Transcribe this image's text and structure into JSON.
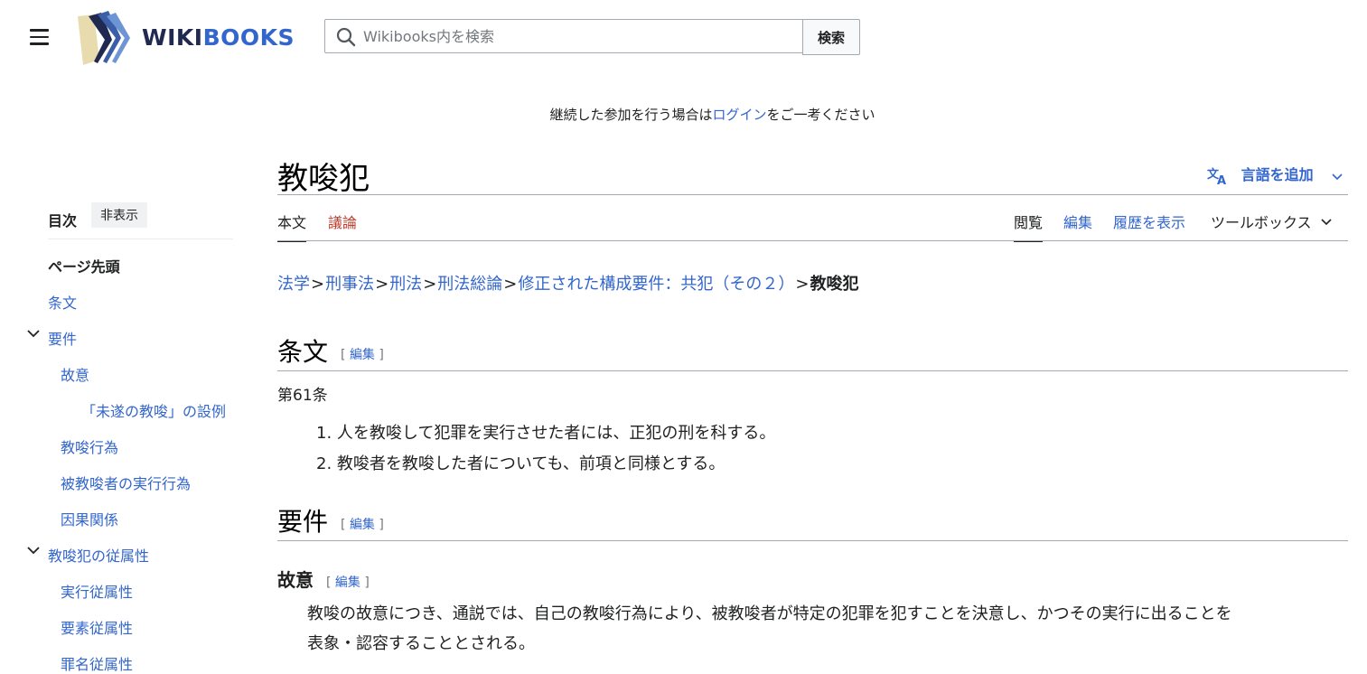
{
  "header": {
    "logo_text_a": "WIKI",
    "logo_text_b": "BOOKS",
    "search_placeholder": "Wikibooks内を検索",
    "search_button": "検索"
  },
  "notice": {
    "before": "継続した参加を行う場合は",
    "link": "ログイン",
    "after": "をご一考ください"
  },
  "toc": {
    "title": "目次",
    "hide": "非表示",
    "items": [
      {
        "label": "ページ先頭",
        "bold": true
      },
      {
        "label": "条文"
      },
      {
        "label": "要件",
        "expandable": true
      },
      {
        "label": "故意"
      },
      {
        "label": "「未遂の教唆」の設例"
      },
      {
        "label": "教唆行為"
      },
      {
        "label": "被教唆者の実行行為"
      },
      {
        "label": "因果関係"
      },
      {
        "label": "教唆犯の従属性",
        "expandable": true
      },
      {
        "label": "実行従属性"
      },
      {
        "label": "要素従属性"
      },
      {
        "label": "罪名従属性"
      }
    ]
  },
  "page": {
    "title": "教唆犯",
    "language_button": "言語を追加",
    "tabs_left": [
      "本文",
      "議論"
    ],
    "tabs_right": [
      "閲覧",
      "編集",
      "履歴を表示",
      "ツールボックス"
    ]
  },
  "breadcrumb": {
    "items": [
      "法学",
      "刑事法",
      "刑法",
      "刑法総論",
      "修正された構成要件：共犯（その２）"
    ],
    "separator": ">",
    "current": "教唆犯"
  },
  "content": {
    "edit_label": "編集",
    "section1_title": "条文",
    "article": "第61条",
    "article_items": [
      "人を教唆して犯罪を実行させた者には、正犯の刑を科する。",
      "教唆者を教唆した者についても、前項と同様とする。"
    ],
    "section2_title": "要件",
    "subsection1_title": "故意",
    "paragraph_line1": "教唆の故意につき、通説では、自己の教唆行為により、被教唆者が特定の犯罪を犯すことを決意し、かつその実行に出ることを",
    "paragraph_line2": "表象・認容することとされる。"
  },
  "colors": {
    "link": "#3366cc",
    "text": "#202122",
    "discussion_red": "#bf3c2c",
    "rule": "#a2a9b1",
    "logo_navy": "#20294f"
  }
}
